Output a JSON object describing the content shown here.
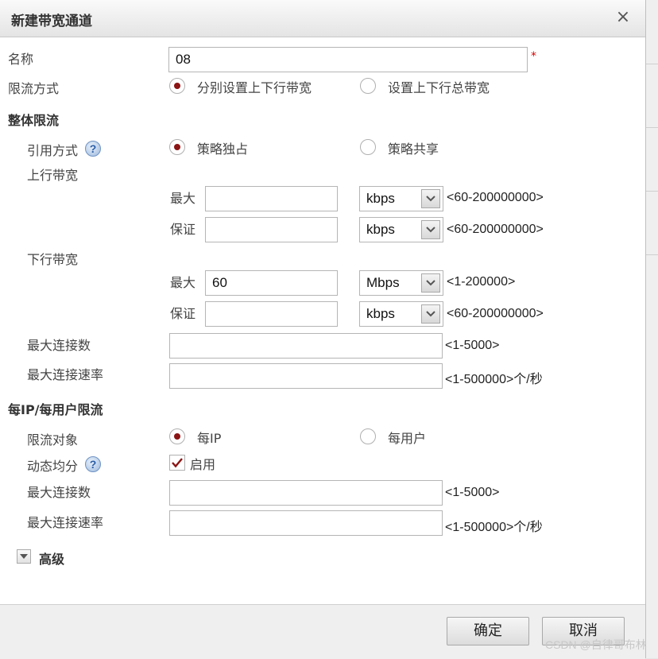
{
  "dialog": {
    "title": "新建带宽通道",
    "close_glyph": "×"
  },
  "name_row": {
    "label": "名称",
    "value": "08",
    "required_mark": "*"
  },
  "limit_mode": {
    "label": "限流方式",
    "options": [
      {
        "label": "分别设置上下行带宽",
        "selected": true
      },
      {
        "label": "设置上下行总带宽",
        "selected": false
      }
    ]
  },
  "overall": {
    "section_title": "整体限流",
    "ref_mode": {
      "label": "引用方式",
      "help_glyph": "?",
      "options": [
        {
          "label": "策略独占",
          "selected": true
        },
        {
          "label": "策略共享",
          "selected": false
        }
      ]
    },
    "upstream": {
      "label": "上行带宽",
      "max": {
        "label": "最大",
        "value": "",
        "unit": "kbps",
        "range": "<60-200000000>"
      },
      "guarantee": {
        "label": "保证",
        "value": "",
        "unit": "kbps",
        "range": "<60-200000000>"
      }
    },
    "downstream": {
      "label": "下行带宽",
      "max": {
        "label": "最大",
        "value": "60",
        "unit": "Mbps",
        "range": "<1-200000>"
      },
      "guarantee": {
        "label": "保证",
        "value": "",
        "unit": "kbps",
        "range": "<60-200000000>"
      }
    },
    "max_connections": {
      "label": "最大连接数",
      "value": "",
      "range": "<1-5000>"
    },
    "max_conn_rate": {
      "label": "最大连接速率",
      "value": "",
      "range": "<1-500000>个/秒"
    }
  },
  "per_ip": {
    "section_title": "每IP/每用户限流",
    "target": {
      "label": "限流对象",
      "options": [
        {
          "label": "每IP",
          "selected": true
        },
        {
          "label": "每用户",
          "selected": false
        }
      ]
    },
    "dynamic_share": {
      "label": "动态均分",
      "help_glyph": "?",
      "checkbox_label": "启用",
      "checked": true
    },
    "max_connections": {
      "label": "最大连接数",
      "value": "",
      "range": "<1-5000>"
    },
    "max_conn_rate": {
      "label": "最大连接速率",
      "value": "",
      "range": "<1-500000>个/秒"
    }
  },
  "advanced": {
    "label": "高级"
  },
  "footer": {
    "ok_label": "确定",
    "cancel_label": "取消"
  },
  "watermark": "CSDN @自律哥布林",
  "colors": {
    "radio_dot": "#8b1414",
    "checkmark": "#8b1414",
    "required": "#dd0000",
    "help_icon": "#2a5ea8"
  }
}
